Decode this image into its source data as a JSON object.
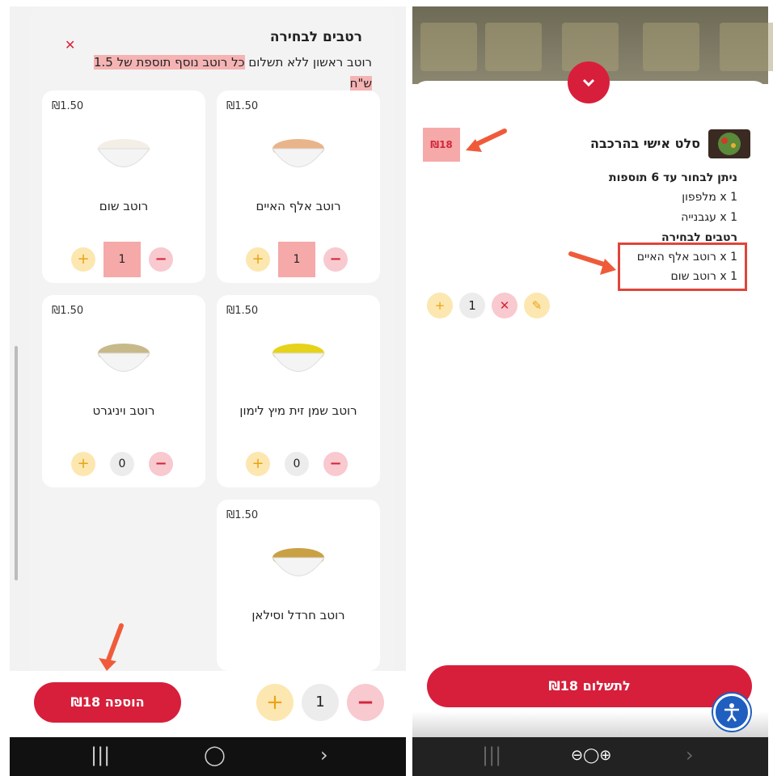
{
  "left": {
    "close": "✕",
    "title": "רטבים לבחירה",
    "desc_part1": "רוטב ראשון ללא תשלום",
    "desc_part2": "כל רוטב נוסף תוספת של 1.5",
    "desc_part3": "ש\"ח",
    "cards": [
      {
        "price": "₪1.50",
        "name": "רוטב אלף האיים",
        "qty": "1"
      },
      {
        "price": "₪1.50",
        "name": "רוטב שום",
        "qty": "1"
      },
      {
        "price": "₪1.50",
        "name": "רוטב שמן זית מיץ לימון",
        "qty": "0"
      },
      {
        "price": "₪1.50",
        "name": "רוטב ויניגרט",
        "qty": "0"
      },
      {
        "price": "₪1.50",
        "name": "רוטב חרדל וסילאן",
        "qty": ""
      }
    ],
    "add_button": "הוספה ₪18",
    "bottom_qty": "1",
    "plus": "+",
    "minus": "−"
  },
  "right": {
    "price_badge": "₪18",
    "title": "סלט אישי בהרכבה",
    "toppings_heading": "ניתן לבחור עד 6 תוספות",
    "toppings": [
      "1 x מלפפון",
      "1 x עגבנייה"
    ],
    "sauces_heading": "רטבים לבחירה",
    "sauces": [
      "1 x רוטב אלף האיים",
      "1 x רוטב שום"
    ],
    "qty": "1",
    "pay_button": "לתשלום ₪18"
  },
  "nav": {
    "recent": "|||",
    "home": "◯",
    "back": "›"
  },
  "colors": {
    "accent": "#d71f3b",
    "highlight": "#f5a9a9",
    "plus_bg": "#fde7b0"
  }
}
